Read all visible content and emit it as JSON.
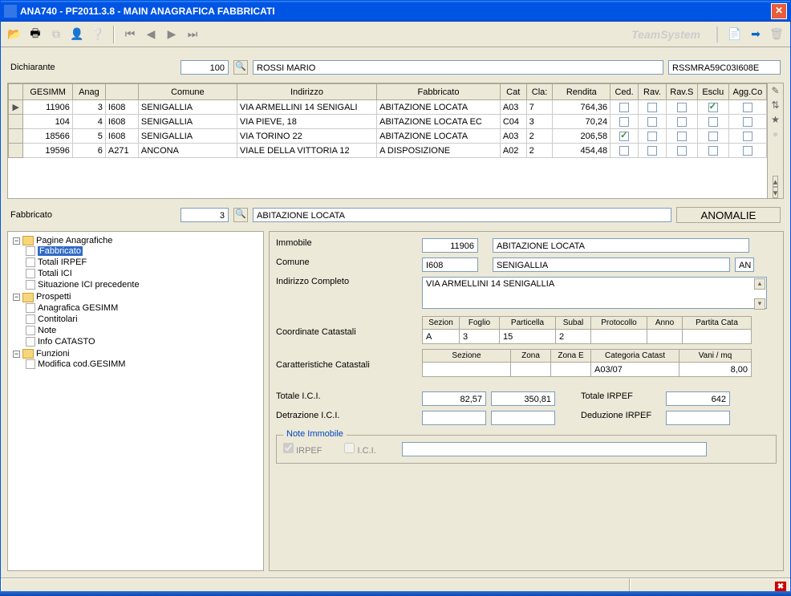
{
  "window": {
    "title": "ANA740  - PF2011.3.8 -  MAIN ANAGRAFICA FABBRICATI"
  },
  "toolbar": {
    "brand": "TeamSystem"
  },
  "dichiarante": {
    "label": "Dichiarante",
    "code": "100",
    "name": "ROSSI MARIO",
    "cf": "RSSMRA59C03I608E"
  },
  "grid": {
    "columns": [
      "GESIMM",
      "Anag",
      "",
      "Comune",
      "Indirizzo",
      "Fabbricato",
      "Cat",
      "Cla:",
      "Rendita",
      "Ced.",
      "Rav.",
      "Rav.S",
      "Esclu",
      "Agg.Co"
    ],
    "rows": [
      {
        "sel": true,
        "gesimm": "11906",
        "anag": "3",
        "code": "I608",
        "comune": "SENIGALLIA",
        "indirizzo": "VIA ARMELLINI 14 SENIGALI",
        "fabbricato": "ABITAZIONE LOCATA",
        "cat": "A03",
        "cla": "7",
        "rendita": "764,36",
        "ced": false,
        "rav": false,
        "ravs": false,
        "esclu": true,
        "agg": false
      },
      {
        "sel": false,
        "gesimm": "104",
        "anag": "4",
        "code": "I608",
        "comune": "SENIGALLIA",
        "indirizzo": "VIA PIEVE, 18",
        "fabbricato": "ABITAZIONE LOCATA EC",
        "cat": "C04",
        "cla": "3",
        "rendita": "70,24",
        "ced": false,
        "rav": false,
        "ravs": false,
        "esclu": false,
        "agg": false
      },
      {
        "sel": false,
        "gesimm": "18566",
        "anag": "5",
        "code": "I608",
        "comune": "SENIGALLIA",
        "indirizzo": "VIA TORINO 22",
        "fabbricato": "ABITAZIONE LOCATA",
        "cat": "A03",
        "cla": "2",
        "rendita": "206,58",
        "ced": true,
        "rav": false,
        "ravs": false,
        "esclu": false,
        "agg": false
      },
      {
        "sel": false,
        "gesimm": "19596",
        "anag": "6",
        "code": "A271",
        "comune": "ANCONA",
        "indirizzo": "VIALE DELLA VITTORIA 12",
        "fabbricato": "A DISPOSIZIONE",
        "cat": "A02",
        "cla": "2",
        "rendita": "454,48",
        "ced": false,
        "rav": false,
        "ravs": false,
        "esclu": false,
        "agg": false
      }
    ]
  },
  "fabbricato_row": {
    "label": "Fabbricato",
    "num": "3",
    "desc": "ABITAZIONE LOCATA",
    "anomalie_btn": "ANOMALIE"
  },
  "tree": {
    "root1": "Pagine Anagrafiche",
    "r1_items": [
      "Fabbricato",
      "Totali IRPEF",
      "Totali ICI",
      "Situazione ICI precedente"
    ],
    "root2": "Prospetti",
    "r2_items": [
      "Anagrafica GESIMM",
      "Contitolari",
      "Note",
      "Info CATASTO"
    ],
    "root3": "Funzioni",
    "r3_items": [
      "Modifica cod.GESIMM"
    ]
  },
  "detail": {
    "immobile_label": "Immobile",
    "immobile_code": "11906",
    "immobile_desc": "ABITAZIONE LOCATA",
    "comune_label": "Comune",
    "comune_code": "I608",
    "comune_desc": "SENIGALLIA",
    "comune_prov": "AN",
    "indirizzo_label": "Indirizzo Completo",
    "indirizzo_val": "VIA ARMELLINI 14 SENIGALLIA",
    "coord_label": "Coordinate Catastali",
    "coord_headers": [
      "Sezion",
      "Foglio",
      "Particella",
      "Subal",
      "Protocollo",
      "Anno",
      "Partita Cata"
    ],
    "coord_vals": [
      "A",
      "3",
      "15",
      "2",
      "",
      "",
      ""
    ],
    "caratt_label": "Caratteristiche Catastali",
    "caratt_headers": [
      "Sezione",
      "Zona",
      "Zona E",
      "Categoria Catast",
      "Vani / mq"
    ],
    "caratt_vals": [
      "",
      "",
      "",
      "A03/07",
      "8,00"
    ],
    "tot_ici_label": "Totale I.C.I.",
    "tot_ici_1": "82,57",
    "tot_ici_2": "350,81",
    "tot_irpef_label": "Totale IRPEF",
    "tot_irpef": "642",
    "detr_ici_label": "Detrazione I.C.I.",
    "detr_ici_1": "",
    "detr_ici_2": "",
    "ded_irpef_label": "Deduzione IRPEF",
    "ded_irpef": "",
    "note_title": "Note Immobile",
    "chk_irpef": "IRPEF",
    "chk_ici": "I.C.I."
  }
}
